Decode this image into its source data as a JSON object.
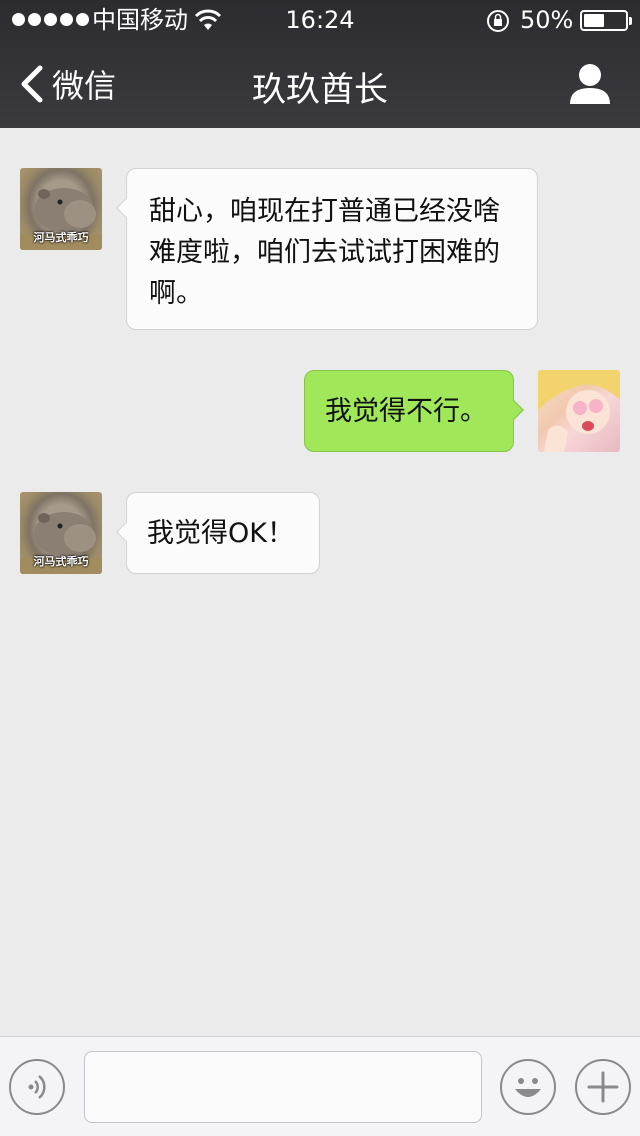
{
  "status_bar": {
    "carrier": "中国移动",
    "time": "16:24",
    "battery_percent": "50%",
    "battery_level": 0.5,
    "signal_bars": 5
  },
  "nav": {
    "back_label": "微信",
    "title": "玖玖酋长",
    "back_icon": "chevron-left-icon",
    "profile_icon": "person-icon"
  },
  "messages": [
    {
      "direction": "incoming",
      "text": "甜心，咱现在打普通已经没啥难度啦，咱们去试试打困难的啊。",
      "avatar_caption": "河马式乖巧"
    },
    {
      "direction": "outgoing",
      "text": "我觉得不行。"
    },
    {
      "direction": "incoming",
      "text": "我觉得OK！",
      "avatar_caption": "河马式乖巧"
    }
  ],
  "input_bar": {
    "voice_icon": "voice-icon",
    "emoji_icon": "emoji-icon",
    "plus_icon": "plus-icon",
    "placeholder": ""
  },
  "colors": {
    "header": "#333338",
    "background": "#ebebeb",
    "incoming_bubble": "#fbfbfb",
    "outgoing_bubble": "#a0e75a"
  }
}
